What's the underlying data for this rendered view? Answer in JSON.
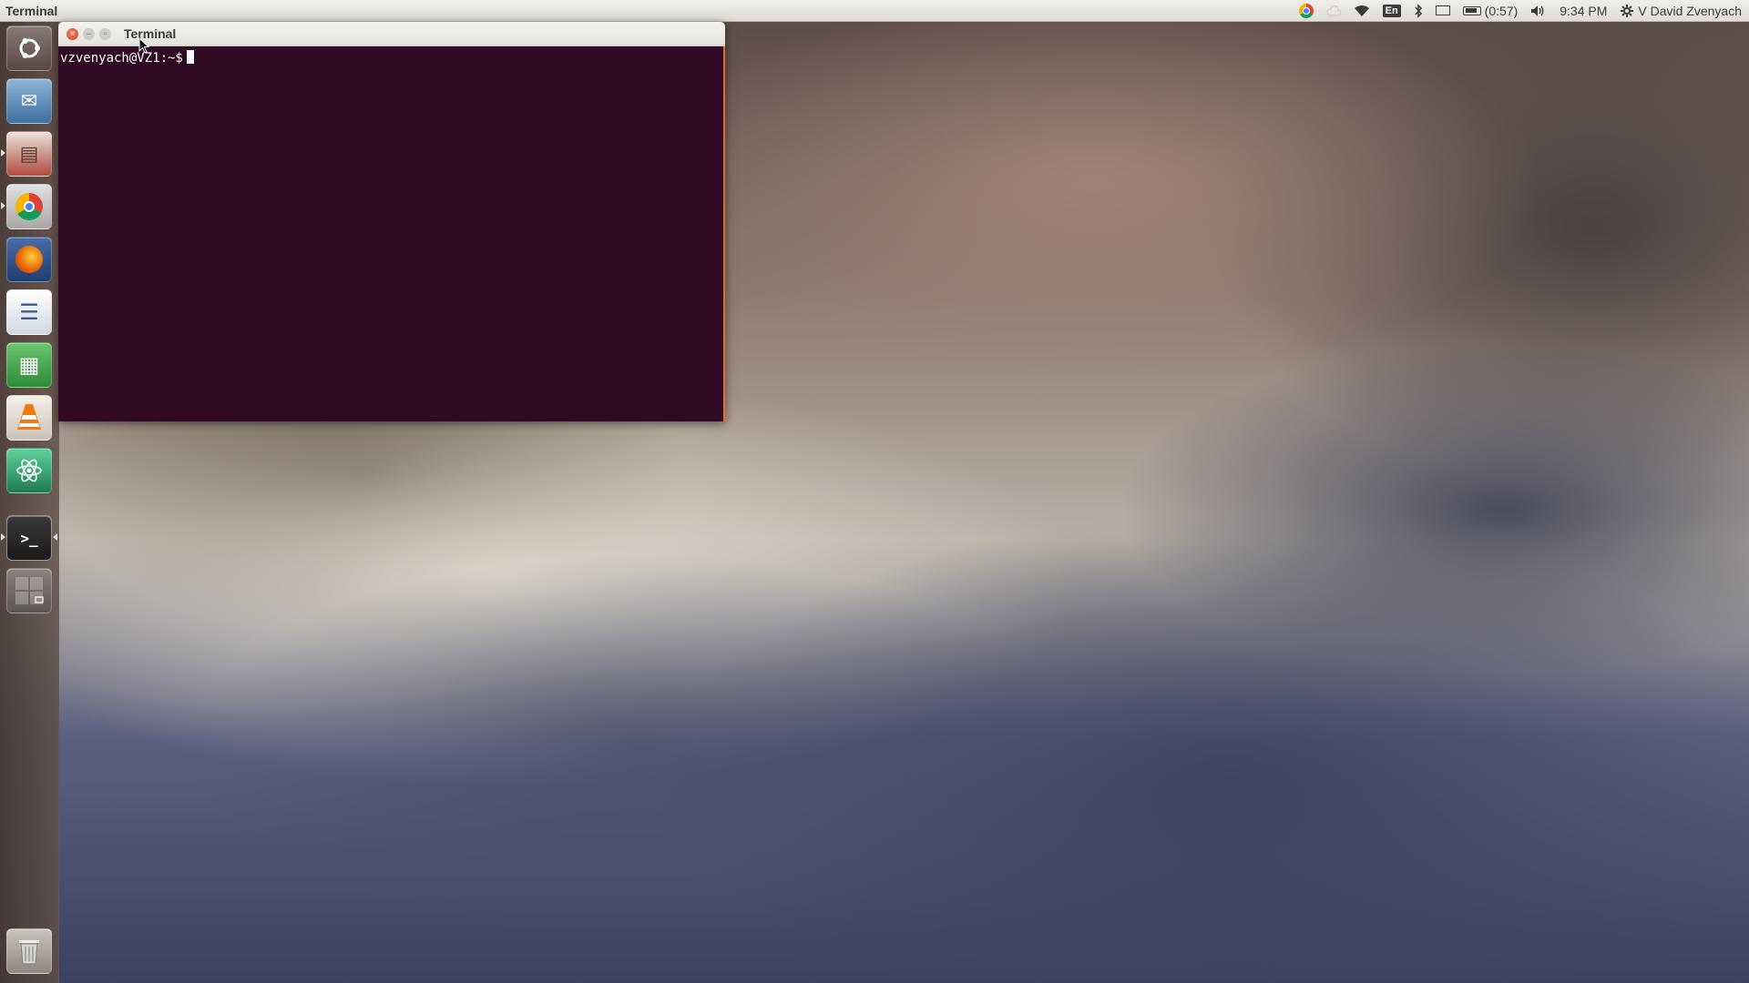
{
  "top_panel": {
    "app_name": "Terminal",
    "language": "En",
    "battery_time": "(0:57)",
    "clock": "9:34 PM",
    "user_name": "V David Zvenyach"
  },
  "launcher": {
    "items": [
      {
        "id": "dash",
        "label": "Dash",
        "icon": "ubuntu-logo-icon",
        "color": "#6b5a55"
      },
      {
        "id": "thunderbird",
        "label": "Thunderbird",
        "icon": "thunderbird-icon",
        "color": "#3d6f9e"
      },
      {
        "id": "files",
        "label": "Files",
        "icon": "file-cabinet-icon",
        "color": "#b24a3c"
      },
      {
        "id": "chrome",
        "label": "Google Chrome",
        "icon": "chrome-icon",
        "color": "#c94236"
      },
      {
        "id": "firefox",
        "label": "Firefox",
        "icon": "firefox-icon",
        "color": "#d85a1e"
      },
      {
        "id": "writer",
        "label": "LibreOffice Writer",
        "icon": "writer-document-icon",
        "color": "#3a5c88"
      },
      {
        "id": "calc",
        "label": "LibreOffice Calc",
        "icon": "calc-spreadsheet-icon",
        "color": "#2e8b3a"
      },
      {
        "id": "vlc",
        "label": "VLC",
        "icon": "vlc-cone-icon",
        "color": "#e07a18"
      },
      {
        "id": "atom",
        "label": "Atom",
        "icon": "atom-icon",
        "color": "#2f9a6a"
      },
      {
        "id": "terminal",
        "label": "Terminal",
        "icon": "terminal-icon",
        "color": "#2b2b2b"
      },
      {
        "id": "workspaces",
        "label": "Workspace Switcher",
        "icon": "workspace-switcher-icon",
        "color": "#6a615d"
      }
    ],
    "trash": {
      "label": "Trash",
      "icon": "trash-icon"
    }
  },
  "terminal": {
    "title": "Terminal",
    "prompt": "vzvenyach@VZ1:~$",
    "background_color": "#300a24",
    "focus_color": "#e8692a"
  }
}
